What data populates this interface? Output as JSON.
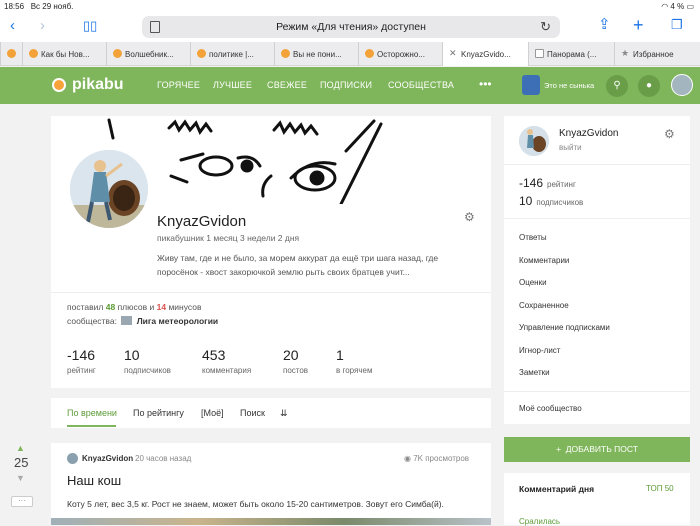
{
  "status_bar": {
    "time": "18:56",
    "date": "Вс 29 нояб.",
    "battery": "4 %"
  },
  "browser": {
    "reader_text": "Режим «Для чтения» доступен",
    "tabs": [
      {
        "label": "Как бы Нов..."
      },
      {
        "label": "Волшебник..."
      },
      {
        "label": "политике |..."
      },
      {
        "label": "Вы не пони..."
      },
      {
        "label": "Осторожно..."
      },
      {
        "label": "KnyazGvido...",
        "active": true
      },
      {
        "label": "Панорама (..."
      },
      {
        "label": "Избранное"
      }
    ]
  },
  "header": {
    "logo": "pikabu",
    "nav": [
      "ГОРЯЧЕЕ",
      "ЛУЧШЕЕ",
      "СВЕЖЕЕ",
      "ПОДПИСКИ",
      "СООБЩЕСТВА"
    ],
    "more": "•••",
    "promo": "Это не сынька"
  },
  "profile": {
    "username": "KnyazGvidon",
    "tenure": "пикабушник 1 месяц 3 недели 2 дня",
    "bio_line1": "Живу там, где и не было, за морем аккурат да ещё три шага назад, где",
    "bio_line2": "поросёнок - хвост закорючкой землю рыть своих братцев учит...",
    "votes_prefix": "поставил",
    "plus_count": "48",
    "plus_word": "плюсов",
    "and_word": "и",
    "minus_count": "14",
    "minus_word": "минусов",
    "communities_label": "сообщества:",
    "community": "Лига метеорологии",
    "stats": [
      {
        "value": "-146",
        "label": "рейтинг"
      },
      {
        "value": "10",
        "label": "подписчиков"
      },
      {
        "value": "453",
        "label": "комментария"
      },
      {
        "value": "20",
        "label": "постов"
      },
      {
        "value": "1",
        "label": "в горячем"
      }
    ]
  },
  "filters": [
    "По времени",
    "По рейтингу",
    "[Моё]",
    "Поиск"
  ],
  "post": {
    "rating": "25",
    "author": "KnyazGvidon",
    "time": "20 часов назад",
    "views": "7K просмотров",
    "title": "Наш кош",
    "text": "Коту 5 лет, вес 3,5 кг. Рост не знаем, может быть около 15-20 сантиметров. Зовут его Симба(й).",
    "more_label": "···"
  },
  "sidebar": {
    "username": "KnyazGvidon",
    "logout": "выйти",
    "rating_value": "-146",
    "rating_label": "рейтинг",
    "subs_value": "10",
    "subs_label": "подписчиков",
    "links": [
      "Ответы",
      "Комментарии",
      "Оценки",
      "Сохраненное",
      "Управление подписками",
      "Игнор-лист",
      "Заметки",
      "Моё сообщество"
    ],
    "add_post": "ДОБАВИТЬ ПОСТ",
    "comment_of_day": "Комментарий дня",
    "top": "ТОП 50",
    "cday_user": "Сралилась"
  }
}
